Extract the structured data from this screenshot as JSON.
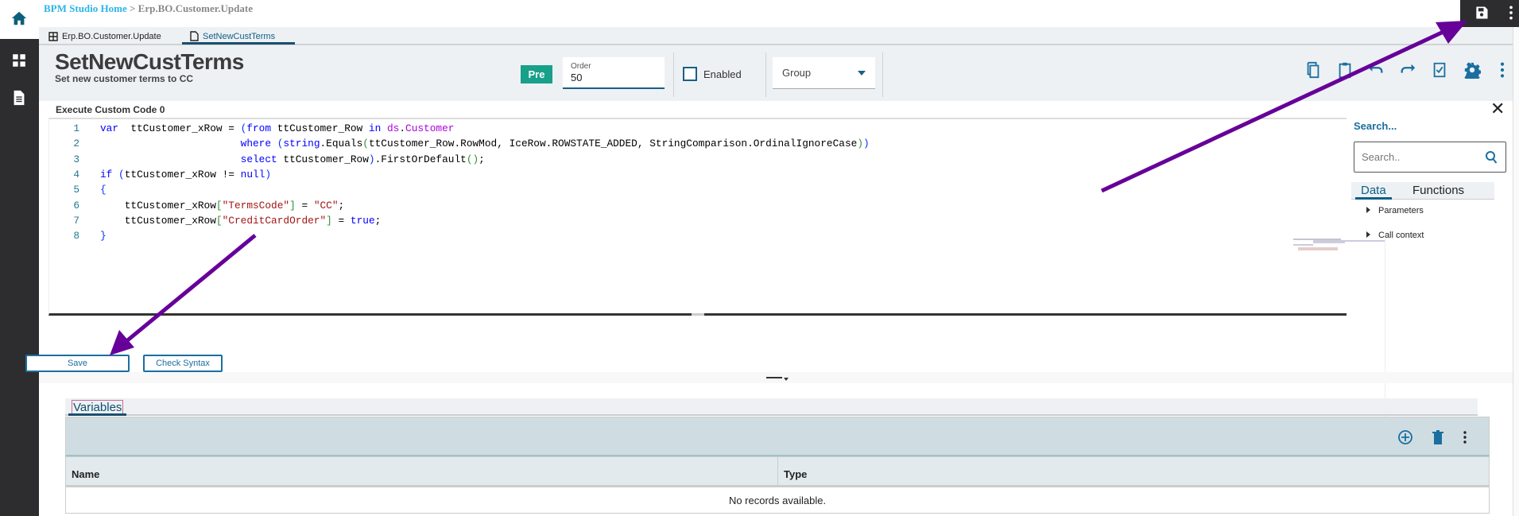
{
  "breadcrumb": {
    "home": "BPM Studio Home",
    "separator": ">",
    "current": "Erp.BO.Customer.Update"
  },
  "tabs": [
    {
      "label": "Erp.BO.Customer.Update",
      "icon": "grid-icon"
    },
    {
      "label": "SetNewCustTerms",
      "icon": "document-icon",
      "active": true
    }
  ],
  "header": {
    "title": "SetNewCustTerms",
    "subtitle": "Set new customer terms to CC",
    "badge": "Pre",
    "order_label": "Order",
    "order_value": "50",
    "enabled_label": "Enabled",
    "enabled_checked": false,
    "group_placeholder": "Group",
    "toolbar_icons": [
      "copy-icon",
      "clipboard-icon",
      "undo-icon",
      "redo-icon",
      "check-icon",
      "gear-icon",
      "more-icon"
    ]
  },
  "panel": {
    "title": "Execute Custom Code 0"
  },
  "code": {
    "line_numbers": [
      "1",
      "2",
      "3",
      "4",
      "5",
      "6",
      "7",
      "8"
    ],
    "lines": [
      [
        [
          "k",
          "var"
        ],
        [
          "",
          "  ttCustomer_xRow = "
        ],
        [
          "b",
          "("
        ],
        [
          "k",
          "from"
        ],
        [
          "",
          " ttCustomer_Row "
        ],
        [
          "k",
          "in"
        ],
        [
          "",
          " "
        ],
        [
          "p",
          "ds"
        ],
        [
          "",
          "."
        ],
        [
          "p",
          "Customer"
        ]
      ],
      [
        [
          "",
          "                       "
        ],
        [
          "k",
          "where"
        ],
        [
          "",
          " "
        ],
        [
          "b",
          "("
        ],
        [
          "k",
          "string"
        ],
        [
          "",
          ".Equals"
        ],
        [
          "y",
          "("
        ],
        [
          "",
          "ttCustomer_Row.RowMod, IceRow.ROWSTATE_ADDED, StringComparison.OrdinalIgnoreCase"
        ],
        [
          "y",
          ")"
        ],
        [
          "b",
          ")"
        ]
      ],
      [
        [
          "",
          "                       "
        ],
        [
          "k",
          "select"
        ],
        [
          "",
          " ttCustomer_Row"
        ],
        [
          "b",
          ")"
        ],
        [
          "",
          ".FirstOrDefault"
        ],
        [
          "y",
          "()"
        ],
        [
          "",
          ";"
        ]
      ],
      [
        [
          "k",
          "if"
        ],
        [
          "",
          " "
        ],
        [
          "b",
          "("
        ],
        [
          "",
          "ttCustomer_xRow != "
        ],
        [
          "k",
          "null"
        ],
        [
          "b",
          ")"
        ]
      ],
      [
        [
          "b",
          "{"
        ]
      ],
      [
        [
          "",
          "    ttCustomer_xRow"
        ],
        [
          "y",
          "["
        ],
        [
          "s",
          "\"TermsCode\""
        ],
        [
          "y",
          "]"
        ],
        [
          "",
          " = "
        ],
        [
          "s",
          "\"CC\""
        ],
        [
          "",
          ";"
        ]
      ],
      [
        [
          "",
          "    ttCustomer_xRow"
        ],
        [
          "y",
          "["
        ],
        [
          "s",
          "\"CreditCardOrder\""
        ],
        [
          "y",
          "]"
        ],
        [
          "",
          " = "
        ],
        [
          "k",
          "true"
        ],
        [
          "",
          ";"
        ]
      ],
      [
        [
          "b",
          "}"
        ]
      ]
    ]
  },
  "side_panel": {
    "search_label": "Search...",
    "search_placeholder": "Search..",
    "tabs": [
      "Data",
      "Functions"
    ],
    "tree": [
      "Parameters",
      "Call context"
    ]
  },
  "buttons": {
    "save": "Save",
    "check_syntax": "Check Syntax"
  },
  "variables": {
    "tab": "Variables",
    "columns": [
      "Name",
      "Type"
    ],
    "empty_text": "No records available."
  },
  "colors": {
    "accent": "#1a6fa0",
    "badge": "#17a08a",
    "annotation_arrow": "#660099"
  }
}
